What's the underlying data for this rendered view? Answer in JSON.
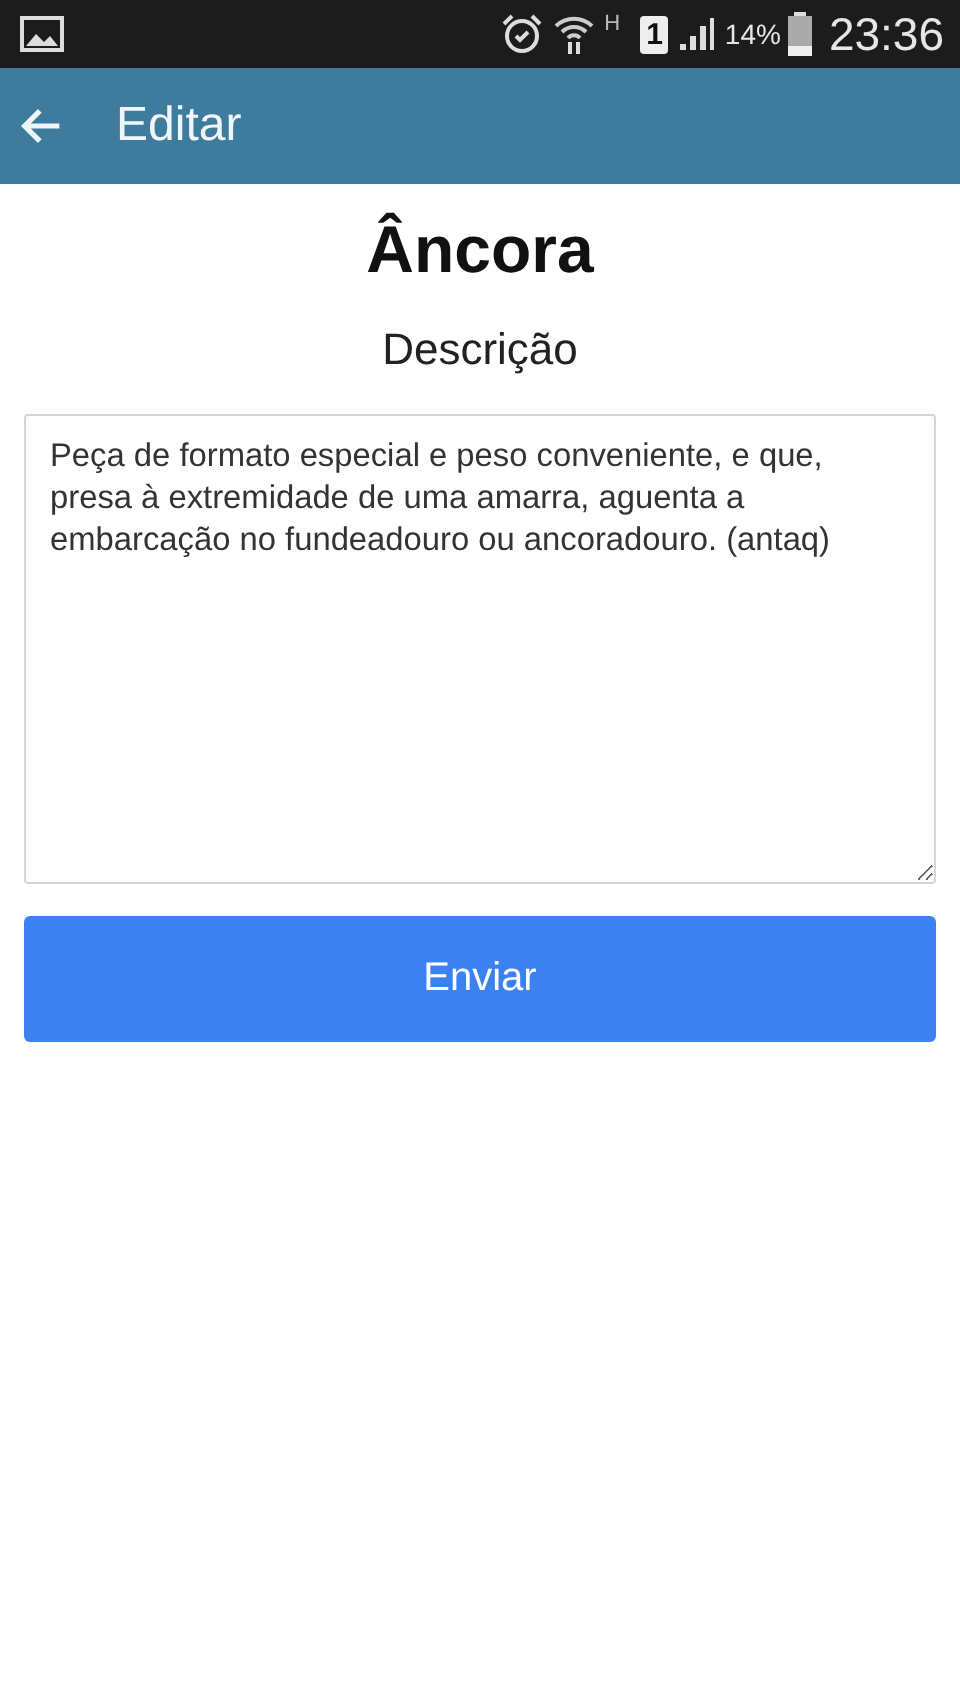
{
  "status_bar": {
    "network_type": "H",
    "sim": "1",
    "battery": "14%",
    "time": "23:36"
  },
  "app_bar": {
    "title": "Editar"
  },
  "heading": "Âncora",
  "label": "Descrição",
  "description": {
    "value": "Peça de formato especial e peso conveniente, e que, presa à extremidade de uma amarra, aguenta a embarcação no fundeadouro ou ancoradouro. (antaq)"
  },
  "submit_button": "Enviar"
}
